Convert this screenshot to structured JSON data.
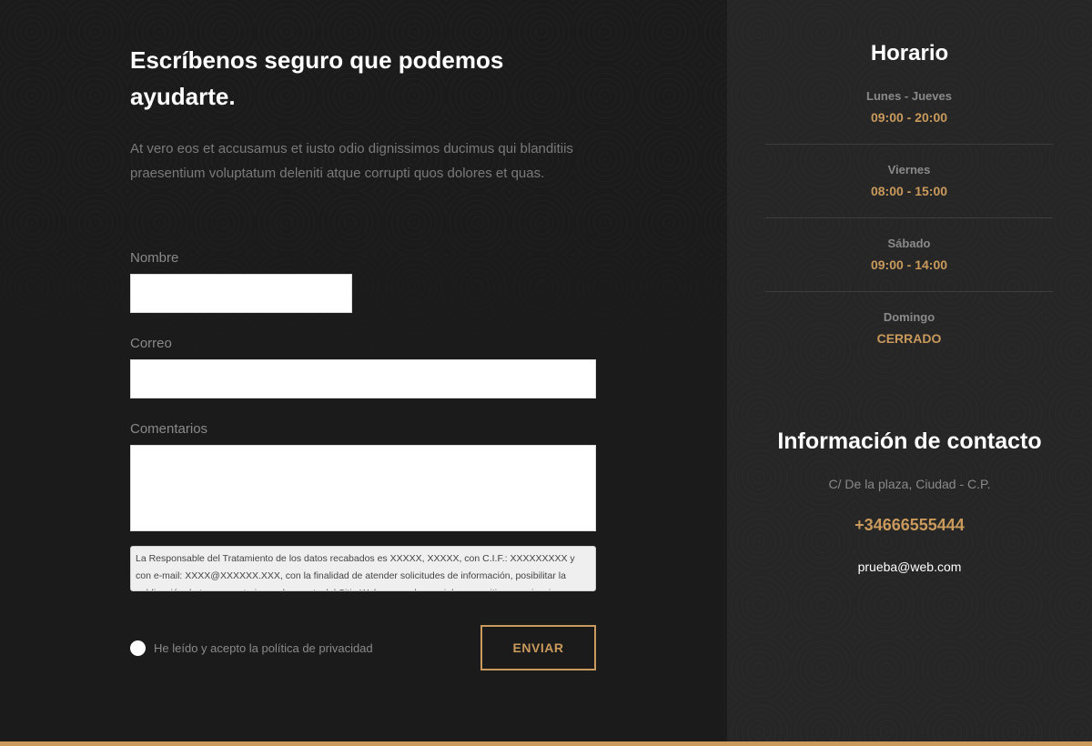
{
  "form": {
    "heading": "Escríbenos seguro que podemos ayudarte.",
    "intro": "At vero eos et accusamus et iusto odio dignissimos ducimus qui blanditiis praesentium voluptatum deleniti atque corrupti quos dolores et quas.",
    "name_label": "Nombre",
    "name_value": "",
    "email_label": "Correo",
    "email_value": "",
    "comments_label": "Comentarios",
    "comments_value": "",
    "privacy_text": "La Responsable del Tratamiento de los datos recabados es XXXXX, XXXXX, con C.I.F.: XXXXXXXXX y con e-mail: XXXX@XXXXXX.XXX, con la finalidad de atender solicitudes de información, posibilitar la publicación de tus comentarios en los posts del Sitio Web y en redes sociales y remitir comunicaciones comerciales.",
    "checkbox_label": "He leído y acepto la política de privacidad",
    "checkbox_checked": false,
    "submit_label": "ENVIAR"
  },
  "schedule": {
    "title": "Horario",
    "items": [
      {
        "day": "Lunes - Jueves",
        "time": "09:00 - 20:00"
      },
      {
        "day": "Viernes",
        "time": "08:00 - 15:00"
      },
      {
        "day": "Sábado",
        "time": "09:00 - 14:00"
      },
      {
        "day": "Domingo",
        "time": "CERRADO"
      }
    ]
  },
  "contact": {
    "title": "Información de contacto",
    "address": "C/ De la plaza, Ciudad - C.P.",
    "phone": "+34666555444",
    "email": "prueba@web.com"
  },
  "colors": {
    "accent": "#c99a5b",
    "background_left": "#1b1b1b",
    "background_right": "#262626"
  }
}
